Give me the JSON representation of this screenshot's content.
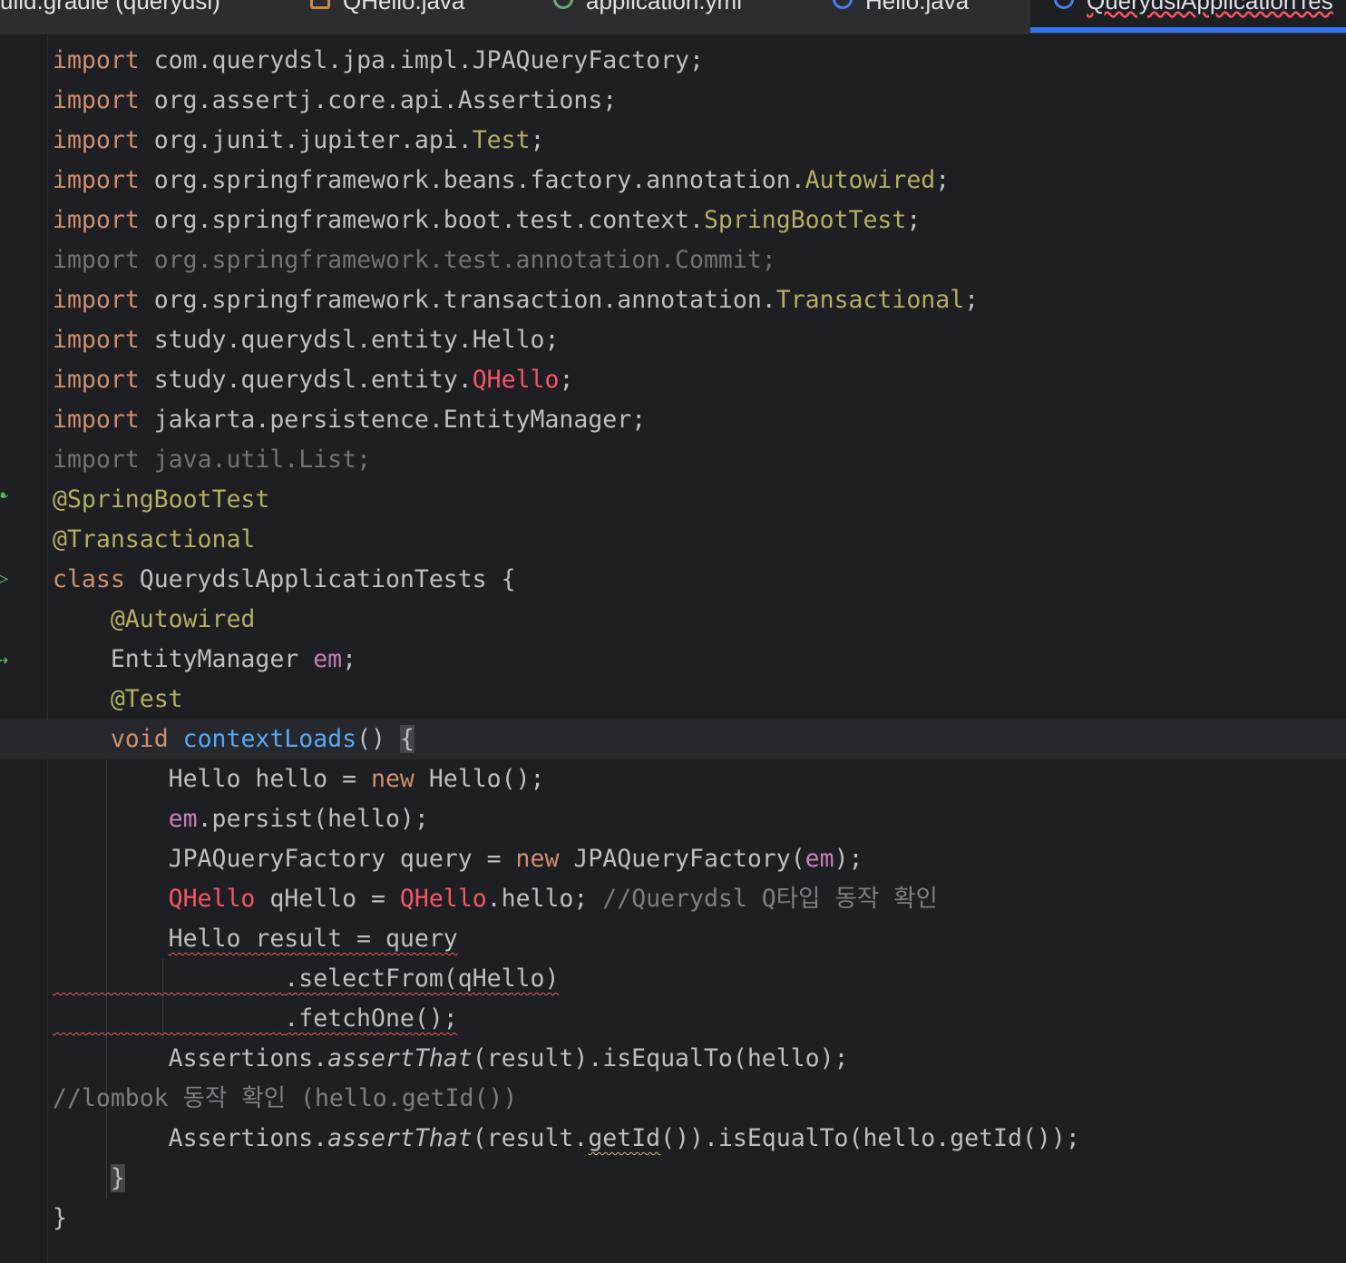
{
  "tabs": [
    {
      "label": "uild.gradle (querydsl)",
      "icon": "gradle-icon"
    },
    {
      "label": "QHello.java",
      "icon": "java-file-icon"
    },
    {
      "label": "application.yml",
      "icon": "yml-file-icon"
    },
    {
      "label": "Hello.java",
      "icon": "class-icon"
    },
    {
      "label": "QuerydslApplicationTes",
      "icon": "class-icon",
      "active": true
    }
  ],
  "code": {
    "imports": [
      {
        "kw": "import",
        "pkg": "com.querydsl.jpa.impl.JPAQueryFactory;",
        "cls": "",
        "end": ""
      },
      {
        "kw": "import",
        "pkg": "org.assertj.core.api.Assertions;",
        "cls": "",
        "end": ""
      },
      {
        "kw": "import",
        "pkg": "org.junit.jupiter.api.",
        "cls": "Test",
        "end": ";"
      },
      {
        "kw": "import",
        "pkg": "org.springframework.beans.factory.annotation.",
        "cls": "Autowired",
        "end": ";"
      },
      {
        "kw": "import",
        "pkg": "org.springframework.boot.test.context.",
        "cls": "SpringBootTest",
        "end": ";"
      },
      {
        "kw": "import",
        "pkg": "org.springframework.test.annotation.Commit;",
        "cls": "",
        "end": ""
      },
      {
        "kw": "import",
        "pkg": "org.springframework.transaction.annotation.",
        "cls": "Transactional",
        "end": ";"
      },
      {
        "kw": "import",
        "pkg": "study.querydsl.entity.Hello;",
        "cls": "",
        "end": ""
      },
      {
        "kw": "import",
        "pkg": "study.querydsl.entity.",
        "cls": "QHello",
        "end": ";"
      },
      {
        "kw": "import",
        "pkg": "jakarta.persistence.EntityManager;",
        "cls": "",
        "end": ""
      },
      {
        "kw": "import",
        "pkg": "java.util.List;",
        "cls": "",
        "end": ""
      }
    ],
    "ann_springboottest": "@SpringBootTest",
    "ann_transactional": "@Transactional",
    "class_kw": "class",
    "class_decl": " QuerydslApplicationTests {",
    "ann_autowired": "@Autowired",
    "field_type": "EntityManager ",
    "field_name": "em",
    "semicolon": ";",
    "ann_test": "@Test",
    "void_kw": "void",
    "method_name": "contextLoads",
    "method_parens": "() ",
    "open_brace": "{",
    "l1_a": "Hello hello = ",
    "l1_new": "new",
    "l1_b": " Hello();",
    "l2_em": "em",
    "l2_b": ".persist(hello);",
    "l3_a": "JPAQueryFactory query = ",
    "l3_new": "new",
    "l3_b": " JPAQueryFactory(",
    "l3_em": "em",
    "l3_c": ");",
    "l4_q1": "QHello",
    "l4_a": " qHello = ",
    "l4_q2": "QHello",
    "l4_b": ".hello; ",
    "l4_cmt": "//Querydsl Q타입 동작 확인",
    "l5": "Hello result = query",
    "l6": ".selectFrom(qHello)",
    "l7": ".fetchOne();",
    "l8_a": "Assertions.",
    "l8_it": "assertThat",
    "l8_b": "(result).isEqualTo(hello);",
    "l9_cmt": "//lombok 동작 확인 (hello.getId())",
    "l10_a": "Assertions.",
    "l10_it": "assertThat",
    "l10_b": "(result.",
    "l10_getid": "getId",
    "l10_c": "()).isEqualTo(hello.getId());",
    "close_method": "}",
    "close_class": "}"
  },
  "colors": {
    "keyword": "#cf8e6d",
    "annotation": "#b3ae60",
    "method": "#56a8f5",
    "field": "#c77dbb",
    "error": "#f75464",
    "accent": "#3574f0"
  }
}
